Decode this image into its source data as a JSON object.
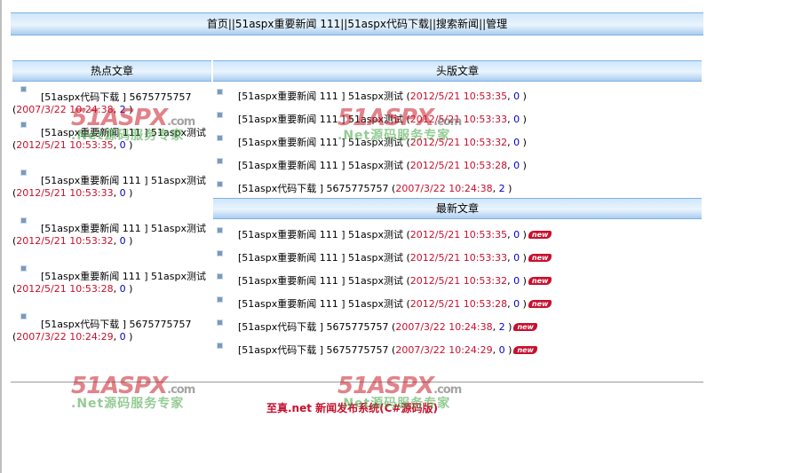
{
  "nav": {
    "items": [
      "首页",
      "51aspx重要新闻 111",
      "51aspx代码下载",
      "搜索新闻",
      "管理"
    ],
    "separator": "||"
  },
  "hot": {
    "title": "热点文章",
    "items": [
      {
        "title": "[51aspx代码下载 ]  5675775757",
        "date": "2007/3/22 10:24:38",
        "count": "2"
      },
      {
        "title": "[51aspx重要新闻 111 ]  51aspx测试",
        "date": "2012/5/21 10:53:35",
        "count": "0"
      },
      {
        "title": "[51aspx重要新闻 111 ]  51aspx测试",
        "date": "2012/5/21 10:53:33",
        "count": "0"
      },
      {
        "title": "[51aspx重要新闻 111 ]  51aspx测试",
        "date": "2012/5/21 10:53:32",
        "count": "0"
      },
      {
        "title": "[51aspx重要新闻 111 ]  51aspx测试",
        "date": "2012/5/21 10:53:28",
        "count": "0"
      },
      {
        "title": "[51aspx代码下载 ]  5675775757",
        "date": "2007/3/22 10:24:29",
        "count": "0"
      }
    ]
  },
  "headline": {
    "title": "头版文章",
    "items": [
      {
        "title": "[51aspx重要新闻 111 ]  51aspx测试",
        "date": "2012/5/21 10:53:35",
        "count": "0"
      },
      {
        "title": "[51aspx重要新闻 111 ]  51aspx测试",
        "date": "2012/5/21 10:53:33",
        "count": "0"
      },
      {
        "title": "[51aspx重要新闻 111 ]  51aspx测试",
        "date": "2012/5/21 10:53:32",
        "count": "0"
      },
      {
        "title": "[51aspx重要新闻 111 ]  51aspx测试",
        "date": "2012/5/21 10:53:28",
        "count": "0"
      },
      {
        "title": "[51aspx代码下载 ]  5675775757",
        "date": "2007/3/22 10:24:38",
        "count": "2"
      }
    ]
  },
  "latest": {
    "title": "最新文章",
    "new_label": "new",
    "items": [
      {
        "title": "[51aspx重要新闻 111 ]  51aspx测试",
        "date": "2012/5/21 10:53:35",
        "count": "0"
      },
      {
        "title": "[51aspx重要新闻 111 ]  51aspx测试",
        "date": "2012/5/21 10:53:33",
        "count": "0"
      },
      {
        "title": "[51aspx重要新闻 111 ]  51aspx测试",
        "date": "2012/5/21 10:53:32",
        "count": "0"
      },
      {
        "title": "[51aspx重要新闻 111 ]  51aspx测试",
        "date": "2012/5/21 10:53:28",
        "count": "0"
      },
      {
        "title": "[51aspx代码下载 ]  5675775757",
        "date": "2007/3/22 10:24:38",
        "count": "2"
      },
      {
        "title": "[51aspx代码下载 ]  5675775757",
        "date": "2007/3/22 10:24:29",
        "count": "0"
      }
    ]
  },
  "footer": {
    "text": "至真.net 新闻发布系统(C#源码版)"
  },
  "watermark": {
    "logo": "51ASPX",
    "domain": ".com",
    "slogan": ".Net源码服务专家"
  },
  "colors": {
    "date": "#c8102e",
    "count": "#0000cc",
    "header_bar": "#cfe6fb"
  }
}
